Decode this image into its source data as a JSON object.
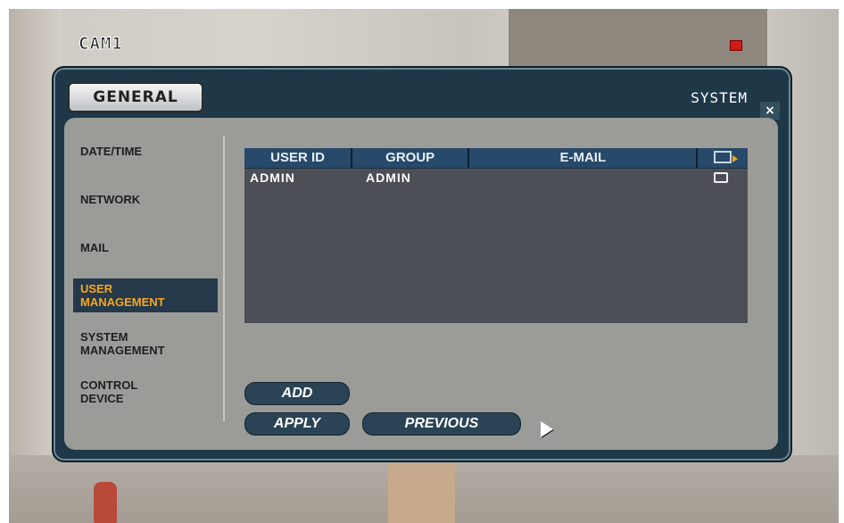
{
  "camera": {
    "label": "CAM1",
    "rec_color": "#d11a1a"
  },
  "dialog": {
    "tab": "GENERAL",
    "section": "SYSTEM",
    "close_icon": "×"
  },
  "sidebar": {
    "items": [
      {
        "label": "DATE/TIME",
        "active": false
      },
      {
        "label": "NETWORK",
        "active": false
      },
      {
        "label": "MAIL",
        "active": false
      },
      {
        "label": "USER\nMANAGEMENT",
        "active": true
      },
      {
        "label": "SYSTEM\nMANAGEMENT",
        "active": false
      },
      {
        "label": "CONTROL\nDEVICE",
        "active": false
      }
    ],
    "active_color": "#f5a623"
  },
  "table": {
    "headers": [
      "USER ID",
      "GROUP",
      "E-MAIL",
      "mail-notify-icon"
    ],
    "rows": [
      {
        "user_id": "ADMIN",
        "group": "ADMIN",
        "email": "",
        "notify": false
      }
    ]
  },
  "buttons": {
    "add": "ADD",
    "apply": "APPLY",
    "previous": "PREVIOUS"
  }
}
